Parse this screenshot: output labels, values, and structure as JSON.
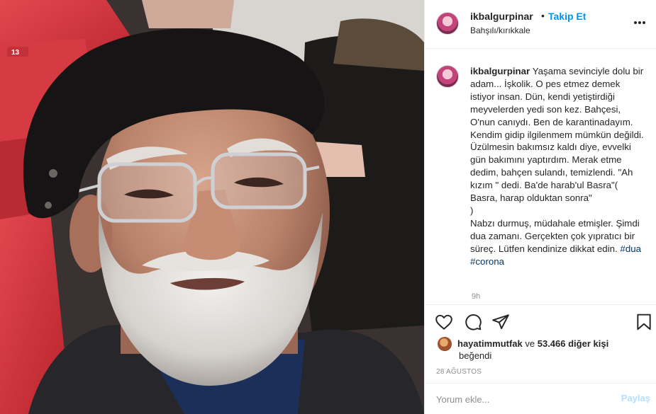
{
  "post": {
    "username": "ikbalgurpinar",
    "follow_separator": "•",
    "follow_label": "Takip Et",
    "location": "Bahşılı/kırıkkale",
    "more_icon": "more-options-icon"
  },
  "caption": {
    "username": "ikbalgurpinar",
    "text": "Yaşama sevinciyle dolu bir adam... İşkolik. O pes etmez demek istiyor insan. Dün, kendi yetiştirdiği meyvelerden yedi son kez. Bahçesi, O'nun canıydı. Ben de karantinadayım. Kendim gidip ilgilenmem mümkün değildi. Üzülmesin bakımsız kaldı diye, evvelki gün bakımını yaptırdım. Merak etme dedim, bahçen sulandı, temizlendi. \"Ah kızım \" dedi. Ba'de harab'ul Basra\"( Basra, harap olduktan sonra\"\n)\nNabzı durmuş, müdahale etmişler. Şimdi dua zamanı. Gerçekten çok yıpratıcı bir süreç. Lütfen kendinize dikkat edin.",
    "hashtag_1": "#dua",
    "hashtag_2": "#corona",
    "time_ago": "9h"
  },
  "actions": {
    "icons": [
      "heart-icon",
      "comment-icon",
      "share-icon",
      "bookmark-icon"
    ]
  },
  "likes": {
    "liker": "hayatimmutfak",
    "connector": "ve",
    "count_text": "53.466 diğer kişi",
    "liked_text": "beğendi"
  },
  "date": "28 AĞUSTOS",
  "comment": {
    "placeholder": "Yorum ekle...",
    "post_label": "Paylaş"
  },
  "colors": {
    "follow_blue": "#0095f6",
    "hashtag": "#00376b",
    "post_button_disabled": "#b2dffc",
    "secondary_text": "#8e8e8e"
  }
}
